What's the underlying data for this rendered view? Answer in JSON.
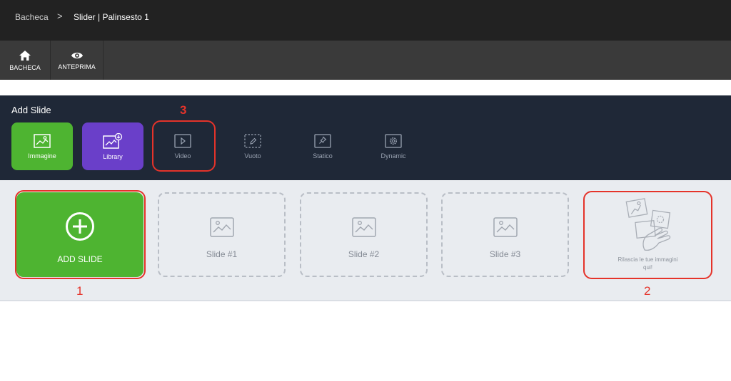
{
  "breadcrumb": {
    "home": "Bacheca",
    "separator": ">",
    "current": "Slider | Palinsesto 1"
  },
  "toolbar": {
    "items": [
      {
        "label": "BACHECA",
        "icon": "home-icon"
      },
      {
        "label": "ANTEPRIMA",
        "icon": "eye-icon"
      }
    ]
  },
  "add_slide_panel": {
    "title": "Add Slide",
    "types": [
      {
        "label": "Immagine",
        "icon": "image-icon",
        "color": "#4eb431"
      },
      {
        "label": "Library",
        "icon": "library-icon",
        "color": "#6a3fc9"
      },
      {
        "label": "Video",
        "icon": "play-icon"
      },
      {
        "label": "Vuoto",
        "icon": "pencil-icon"
      },
      {
        "label": "Statico",
        "icon": "pin-icon"
      },
      {
        "label": "Dynamic",
        "icon": "gear-icon"
      }
    ]
  },
  "slides": {
    "add_label": "ADD SLIDE",
    "items": [
      {
        "label": "Slide #1"
      },
      {
        "label": "Slide #2"
      },
      {
        "label": "Slide #3"
      }
    ],
    "drop_zone": "Rilascia le tue immagini qui!"
  },
  "annotations": {
    "color": "#e5332a",
    "numbers": [
      "1",
      "2",
      "3"
    ]
  }
}
